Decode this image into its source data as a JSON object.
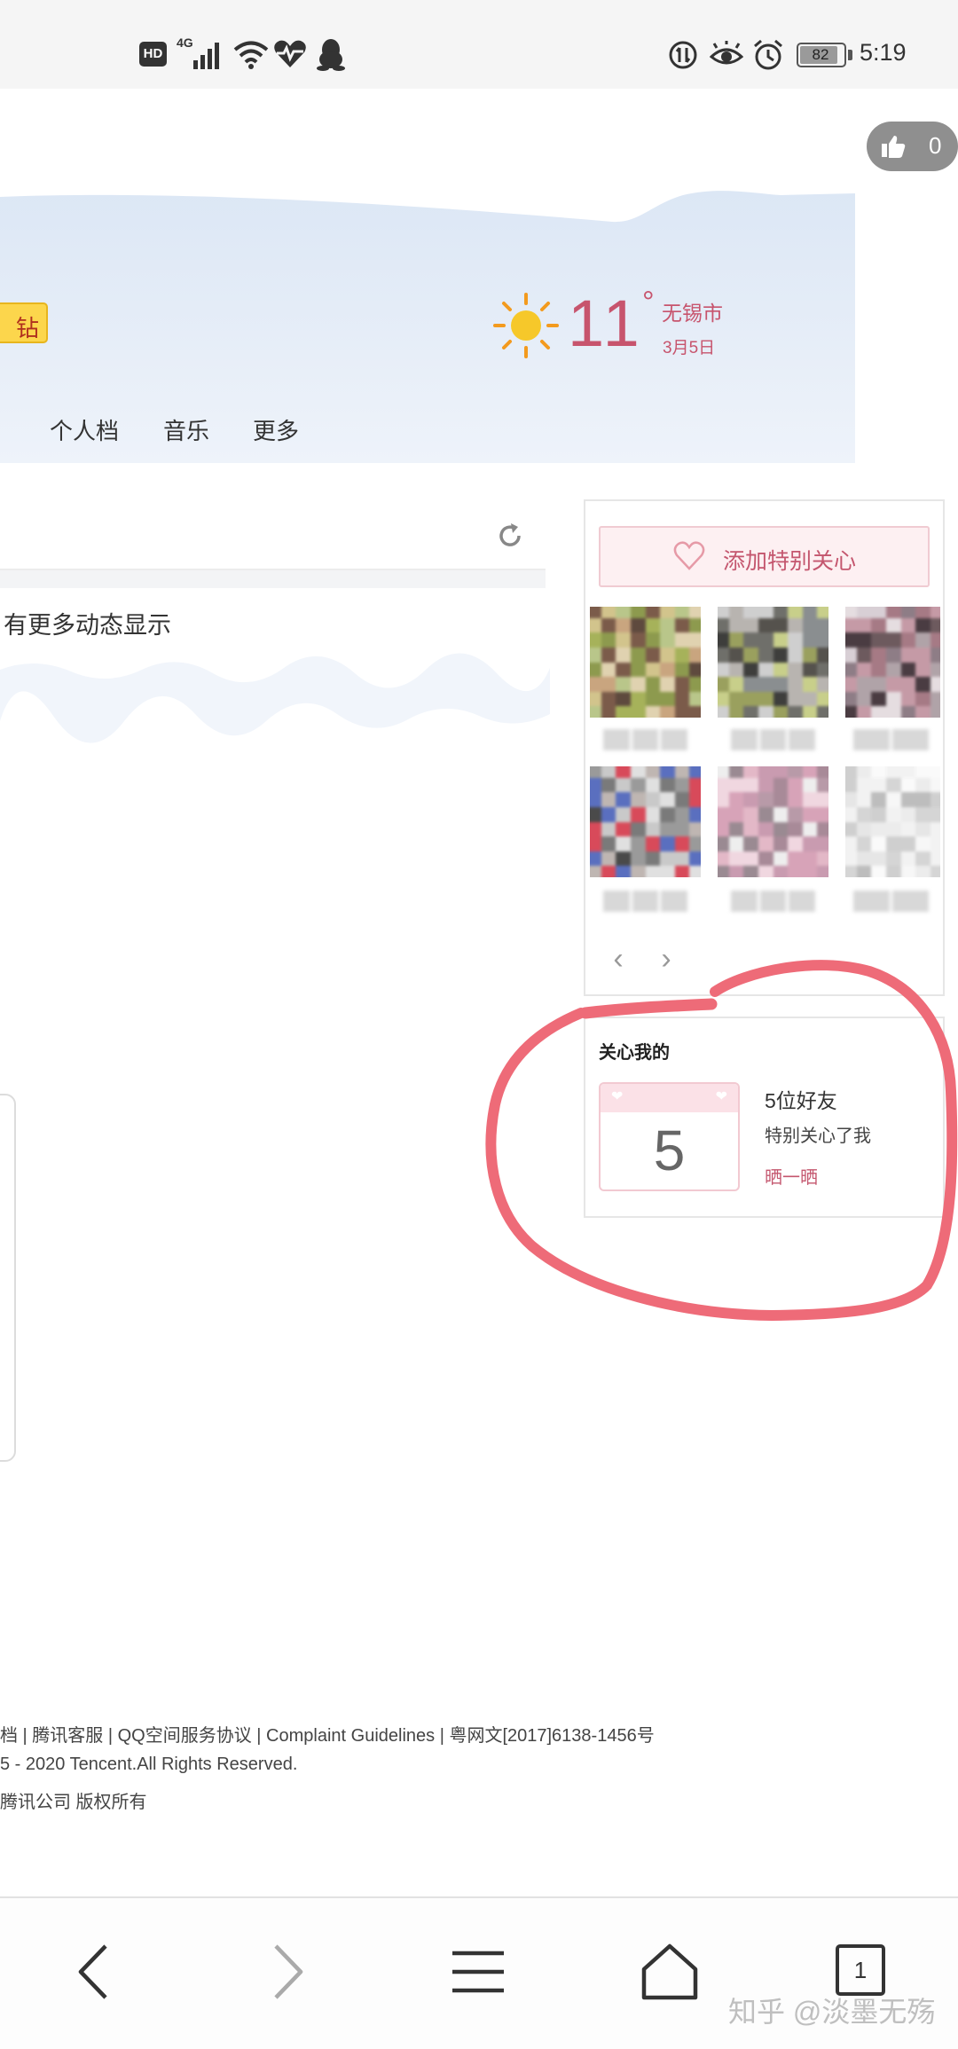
{
  "status_bar": {
    "hd": "HD",
    "network": "4G",
    "battery": "82",
    "time": "5:19"
  },
  "like": {
    "count": "0"
  },
  "header": {
    "badge": "钻",
    "weather": {
      "temp": "11",
      "degree": "°",
      "city": "无锡市",
      "date": "3月5日",
      "icon": "sun-icon"
    },
    "nav": [
      "个人档",
      "音乐",
      "更多"
    ]
  },
  "feed": {
    "empty_text": "有更多动态显示"
  },
  "special_care": {
    "add_label": "添加特别关心"
  },
  "cares_me": {
    "title": "关心我的",
    "count": "5",
    "friends_text": "5位好友",
    "desc": "特别关心了我",
    "share_label": "晒一晒"
  },
  "footer": {
    "line1": "档 | 腾讯客服 | QQ空间服务协议 | Complaint Guidelines | 粤网文[2017]6138-1456号",
    "line2": "5 - 2020 Tencent.All Rights Reserved.",
    "line3": "腾讯公司 版权所有"
  },
  "bottom_nav": {
    "tab_count": "1"
  },
  "watermark": "知乎 @淡墨无殇",
  "colors": {
    "accent_pink": "#c7546d",
    "annotation_red": "#ee6b78",
    "badge_yellow": "#fcd64c",
    "banner_blue": "#e2ecf8"
  }
}
